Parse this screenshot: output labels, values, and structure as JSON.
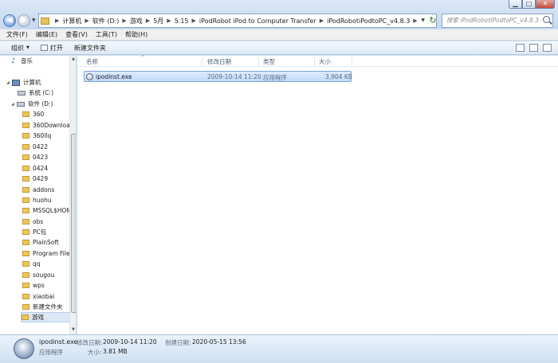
{
  "window": {
    "minimize_glyph": "▁",
    "maximize_glyph": "□",
    "close_glyph": "✕"
  },
  "nav": {
    "back_glyph": "◀",
    "forward_glyph": "▶",
    "history_glyph": "▼"
  },
  "address": {
    "crumbs": [
      "计算机",
      "软件 (D:)",
      "游戏",
      "5月",
      "5.15",
      "iPodRobot iPod to Computer Transfer",
      "iPodRobotiPodtoPC_v4.8.3"
    ],
    "separator": "▶",
    "dropdown_glyph": "▼",
    "refresh_glyph": "↻"
  },
  "search": {
    "placeholder": "搜索 iPodRobotiPodtoPC_v4.8.3"
  },
  "menu": [
    "文件(F)",
    "编辑(E)",
    "查看(V)",
    "工具(T)",
    "帮助(H)"
  ],
  "commands": {
    "organize": "组织",
    "open": "打开",
    "new_folder": "新建文件夹",
    "caret": "▼"
  },
  "sidebar": {
    "items": [
      {
        "label": "音乐",
        "icon": "music-icon"
      },
      {
        "label": "计算机",
        "icon": "computer-icon"
      },
      {
        "label": "系统 (C:)",
        "icon": "drive-icon"
      },
      {
        "label": "软件 (D:)",
        "icon": "drive-icon"
      },
      {
        "label": "360",
        "icon": "folder-icon"
      },
      {
        "label": "360Download",
        "icon": "folder-icon"
      },
      {
        "label": "360llq",
        "icon": "folder-icon"
      },
      {
        "label": "0422",
        "icon": "folder-icon"
      },
      {
        "label": "0423",
        "icon": "folder-icon"
      },
      {
        "label": "0424",
        "icon": "folder-icon"
      },
      {
        "label": "0429",
        "icon": "folder-icon"
      },
      {
        "label": "addons",
        "icon": "folder-icon"
      },
      {
        "label": "huohu",
        "icon": "folder-icon"
      },
      {
        "label": "MSSQL$HOM",
        "icon": "folder-icon"
      },
      {
        "label": "obs",
        "icon": "folder-icon"
      },
      {
        "label": "PC包",
        "icon": "folder-icon"
      },
      {
        "label": "PlainSoft",
        "icon": "folder-icon"
      },
      {
        "label": "Program Files",
        "icon": "folder-icon"
      },
      {
        "label": "qq",
        "icon": "folder-icon"
      },
      {
        "label": "sougou",
        "icon": "folder-icon"
      },
      {
        "label": "wps",
        "icon": "folder-icon"
      },
      {
        "label": "xiaobai",
        "icon": "folder-icon"
      },
      {
        "label": "新建文件夹",
        "icon": "folder-icon"
      },
      {
        "label": "游戏",
        "icon": "folder-icon"
      }
    ],
    "scroll_up_glyph": "▲",
    "scroll_down_glyph": "▼"
  },
  "columns": {
    "name": "名称",
    "modified": "修改日期",
    "type": "类型",
    "size": "大小",
    "sort_glyph": "^"
  },
  "files": [
    {
      "name": "ipodinst.exe",
      "modified": "2009-10-14 11:20",
      "type": "应用程序",
      "size": "3,904 KB"
    }
  ],
  "details": {
    "filename": "ipodinst.exe",
    "type": "应用程序",
    "modified_label": "修改日期:",
    "modified_value": "2009-10-14 11:20",
    "created_label": "创建日期:",
    "created_value": "2020-05-15 13:56",
    "size_label": "大小:",
    "size_value": "3.81 MB"
  }
}
